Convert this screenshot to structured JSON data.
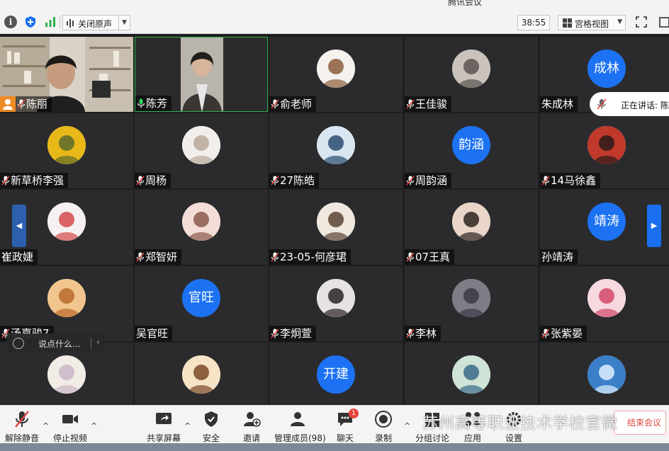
{
  "window": {
    "title": "腾讯会议"
  },
  "topbar": {
    "noise_label": "关闭原声",
    "timer": "38:55",
    "view_label": "宫格视图"
  },
  "participants": [
    {
      "name": "陈丽",
      "type": "video",
      "mic": "muted"
    },
    {
      "name": "陈芳",
      "type": "video",
      "mic": "active"
    },
    {
      "name": "俞老师",
      "type": "avatar-image",
      "mic": "muted"
    },
    {
      "name": "王佳骏",
      "type": "avatar-image",
      "mic": "muted"
    },
    {
      "name": "朱成林",
      "type": "avatar-text",
      "avatar_text": "成林",
      "mic": "none"
    },
    {
      "name": "新草桥李强",
      "type": "avatar-image",
      "mic": "muted"
    },
    {
      "name": "周杨",
      "type": "avatar-image",
      "mic": "muted"
    },
    {
      "name": "27陈皓",
      "type": "avatar-image",
      "mic": "muted"
    },
    {
      "name": "周韵涵",
      "type": "avatar-text",
      "avatar_text": "韵涵",
      "mic": "muted"
    },
    {
      "name": "14马徐鑫",
      "type": "avatar-image",
      "mic": "muted"
    },
    {
      "name": "崔政婕",
      "type": "avatar-image",
      "mic": "none"
    },
    {
      "name": "郑智妍",
      "type": "avatar-image",
      "mic": "muted"
    },
    {
      "name": "23-05-何彦珺",
      "type": "avatar-image",
      "mic": "muted"
    },
    {
      "name": "07王真",
      "type": "avatar-image",
      "mic": "muted"
    },
    {
      "name": "孙靖涛",
      "type": "avatar-text",
      "avatar_text": "靖涛",
      "mic": "none"
    },
    {
      "name": "汤嘉骏7",
      "type": "avatar-image",
      "mic": "muted"
    },
    {
      "name": "吴官旺",
      "type": "avatar-text",
      "avatar_text": "官旺",
      "mic": "none"
    },
    {
      "name": "李炯萱",
      "type": "avatar-image",
      "mic": "muted"
    },
    {
      "name": "李林",
      "type": "avatar-image",
      "mic": "muted"
    },
    {
      "name": "张紫晏",
      "type": "avatar-image",
      "mic": "muted"
    },
    {
      "name": "",
      "type": "avatar-image",
      "mic": "none"
    },
    {
      "name": "",
      "type": "avatar-image",
      "mic": "none"
    },
    {
      "name": "",
      "type": "avatar-text",
      "avatar_text": "开建",
      "mic": "none"
    },
    {
      "name": "",
      "type": "avatar-image",
      "mic": "none"
    },
    {
      "name": "",
      "type": "avatar-image",
      "mic": "none"
    }
  ],
  "speaking": {
    "label": "正在讲话: 陈"
  },
  "chat": {
    "placeholder": "说点什么..."
  },
  "toolbar": {
    "unmute": "解除静音",
    "stop_video": "停止视频",
    "share": "共享屏幕",
    "security": "安全",
    "invite": "邀请",
    "manage": "管理成员(98)",
    "chat": "聊天",
    "chat_badge": "1",
    "record": "录制",
    "breakout": "分组讨论",
    "apps": "应用",
    "settings": "设置",
    "end": "结束会议"
  },
  "watermark": "苏州高等职业技术学校官微",
  "colors": {
    "accent": "#1c72f2",
    "speaking": "#29b34a",
    "muted": "#e0463f"
  }
}
